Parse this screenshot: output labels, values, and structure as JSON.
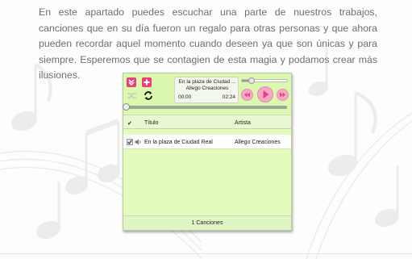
{
  "intro": {
    "text": "En este apartado puedes escuchar una parte de nuestros trabajos, canciones que en su día fueron un regalo para otras personas y que ahora pueden recordar aquel momento cuando deseen ya que son únicas y para siempre. Esperemos que se contagien de esta magia y podamos crear más ilusiones."
  },
  "player": {
    "now_playing": {
      "title": "En la plaza de Ciudad ...",
      "artist": "Allego Creaciones",
      "current_time": "00:00",
      "total_time": "02:24"
    },
    "volume_fraction": 0.2,
    "progress_fraction": 0.0,
    "columns": {
      "check": "✔",
      "title": "Título",
      "artist": "Artista"
    },
    "tracks": [
      {
        "title": "En la plaza de Ciudad Real",
        "artist": "Allego Creaciones"
      }
    ],
    "footer": "1 Canciones",
    "colors": {
      "panel": "#e3fbbb",
      "accent_pink": "#e8407e",
      "button_pink": "#f6aac6",
      "repeat_green": "#2d8a2d"
    },
    "icons": [
      "collapse-icon",
      "add-icon",
      "shuffle-icon",
      "repeat-icon",
      "previous-icon",
      "play-icon",
      "next-icon",
      "checkbox-icon",
      "speaker-icon"
    ]
  }
}
